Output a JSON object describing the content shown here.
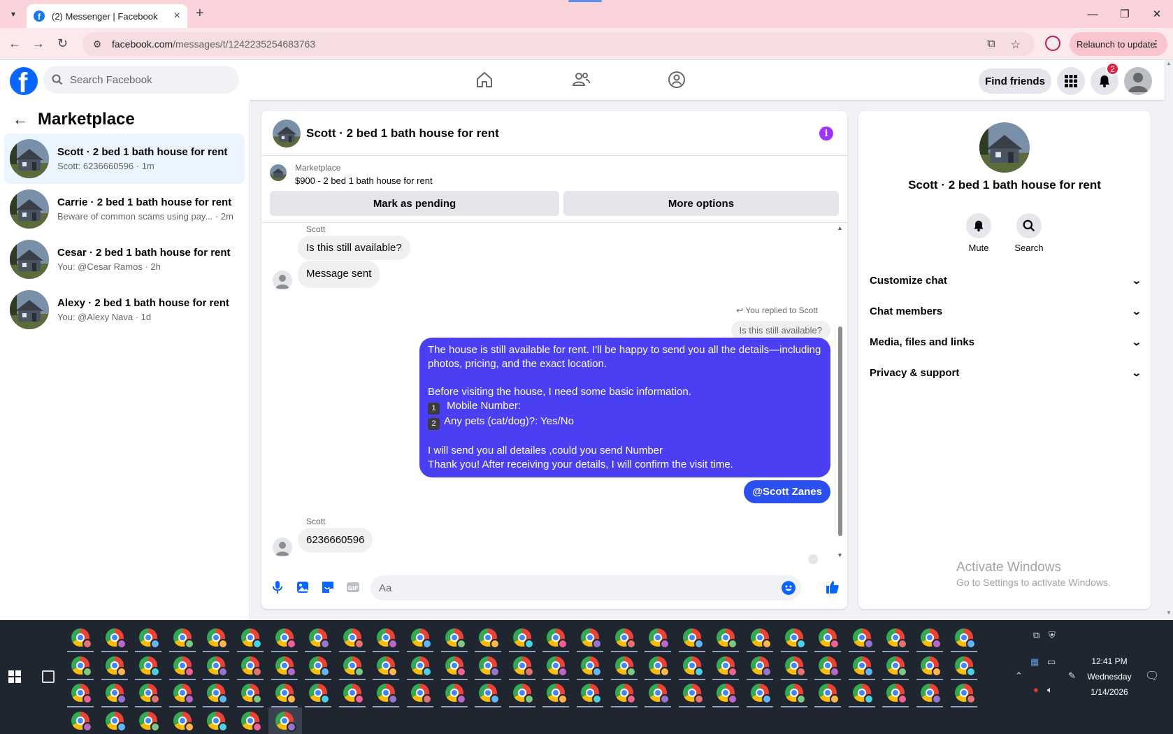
{
  "browser": {
    "tab_title": "(2) Messenger | Facebook",
    "url_domain": "facebook.com",
    "url_path": "/messages/t/1242235254683763",
    "relaunch_label": "Relaunch to update"
  },
  "fb_nav": {
    "search_placeholder": "Search Facebook",
    "find_friends_label": "Find friends",
    "notification_count": "2"
  },
  "sidebar": {
    "title": "Marketplace",
    "conversations": [
      {
        "name": "Scott · 2 bed 1 bath house for rent",
        "preview": "Scott: 6236660596 · 1m",
        "active": true
      },
      {
        "name": "Carrie · 2 bed 1 bath house for rent",
        "preview": "Beware of common scams using pay... · 2m",
        "active": false
      },
      {
        "name": "Cesar · 2 bed 1 bath house for rent",
        "preview": "You: @Cesar Ramos · 2h",
        "active": false
      },
      {
        "name": "Alexy · 2 bed 1 bath house for rent",
        "preview": "You: @Alexy Nava · 1d",
        "active": false
      }
    ]
  },
  "chat": {
    "header_name": "Scott · 2 bed 1 bath house for rent",
    "listing": {
      "source": "Marketplace",
      "title": "$900 - 2 bed 1 bath house for rent",
      "mark_pending_label": "Mark as pending",
      "more_options_label": "More options"
    },
    "messages": {
      "sender_1": "Scott",
      "msg_1": "Is this still available?",
      "msg_2": "Message sent",
      "replied_label": "You replied to Scott",
      "quoted": "Is this still available?",
      "reply_lines": [
        "The house is still available for rent. I'll be happy to send you all the details—including",
        "photos, pricing, and the exact location.",
        "",
        "Before visiting the house, I need some basic information.",
        "Mobile Number:",
        "Any pets (cat/dog)?: Yes/No",
        "",
        "I will send you all detailes ,could you send Number",
        "Thank you! After receiving your details, I will confirm the visit time."
      ],
      "key_1": "1",
      "key_2": "2",
      "mention": "@Scott Zanes",
      "sender_2": "Scott",
      "msg_3": "6236660596"
    },
    "composer_placeholder": "Aa",
    "composer_icons": [
      "microphone-icon",
      "photo-icon",
      "sticker-icon",
      "gif-icon",
      "emoji-icon",
      "like-icon"
    ]
  },
  "info_panel": {
    "name": "Scott · 2 bed 1 bath house for rent",
    "mute_label": "Mute",
    "search_label": "Search",
    "sections": [
      "Customize chat",
      "Chat members",
      "Media, files and links",
      "Privacy & support"
    ],
    "watermark_line1": "Activate Windows",
    "watermark_line2": "Go to Settings to activate Windows."
  },
  "taskbar": {
    "time": "12:41 PM",
    "day": "Wednesday",
    "date": "1/14/2026"
  },
  "colors": {
    "fb_blue": "#0866ff",
    "outgoing_bubble": "#4a3ff2",
    "mention_bubble": "#2b50f0",
    "info_purple": "#a033ff",
    "tab_bar_pink": "#fbd3da"
  }
}
